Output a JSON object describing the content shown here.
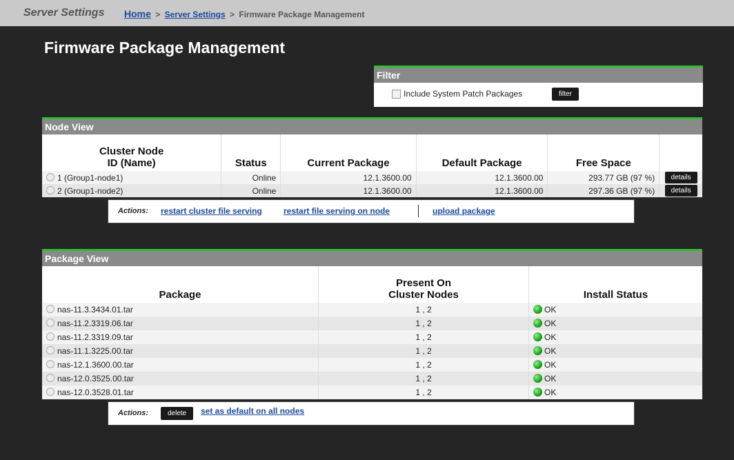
{
  "topbar": {
    "app_title": "Server Settings",
    "crumb_home": "Home",
    "crumb_sep1": ">",
    "crumb_server_settings": "Server Settings",
    "crumb_sep2": ">",
    "crumb_current": "Firmware Package Management"
  },
  "page": {
    "title": "Firmware Package Management"
  },
  "filter": {
    "title": "Filter",
    "checkbox_label": "Include System Patch Packages",
    "checked": false,
    "button_label": "filter"
  },
  "node_view": {
    "title": "Node View",
    "headers": {
      "id_line1": "Cluster Node",
      "id_line2": "ID (Name)",
      "status": "Status",
      "current": "Current Package",
      "default": "Default Package",
      "free": "Free Space"
    },
    "rows": [
      {
        "id": "1 (Group1-node1)",
        "status": "Online",
        "current": "12.1.3600.00",
        "default": "12.1.3600.00",
        "free": "293.77 GB (97 %)",
        "button": "details"
      },
      {
        "id": "2 (Group1-node2)",
        "status": "Online",
        "current": "12.1.3600.00",
        "default": "12.1.3600.00",
        "free": "297.36 GB (97 %)",
        "button": "details"
      }
    ],
    "actions": {
      "label": "Actions:",
      "restart_cluster": "restart cluster file serving",
      "restart_node": "restart file serving on node",
      "upload": "upload package"
    }
  },
  "package_view": {
    "title": "Package View",
    "headers": {
      "package": "Package",
      "present_line1": "Present On",
      "present_line2": "Cluster Nodes",
      "install": "Install Status"
    },
    "rows": [
      {
        "package": "nas-11.3.3434.01.tar",
        "nodes": "1 , 2",
        "status": "OK"
      },
      {
        "package": "nas-11.2.3319.06.tar",
        "nodes": "1 , 2",
        "status": "OK"
      },
      {
        "package": "nas-11.2.3319.09.tar",
        "nodes": "1 , 2",
        "status": "OK"
      },
      {
        "package": "nas-11.1.3225.00.tar",
        "nodes": "1 , 2",
        "status": "OK"
      },
      {
        "package": "nas-12.1.3600.00.tar",
        "nodes": "1 , 2",
        "status": "OK"
      },
      {
        "package": "nas-12.0.3525.00.tar",
        "nodes": "1 , 2",
        "status": "OK"
      },
      {
        "package": "nas-12.0.3528.01.tar",
        "nodes": "1 , 2",
        "status": "OK"
      }
    ],
    "actions": {
      "label": "Actions:",
      "delete": "delete",
      "set_default": "set as default on all nodes"
    }
  },
  "colors": {
    "accent_green": "#2fbf2f",
    "link_blue": "#1b4a9c",
    "background": "#252525",
    "header_grey": "#8a8a8a"
  }
}
